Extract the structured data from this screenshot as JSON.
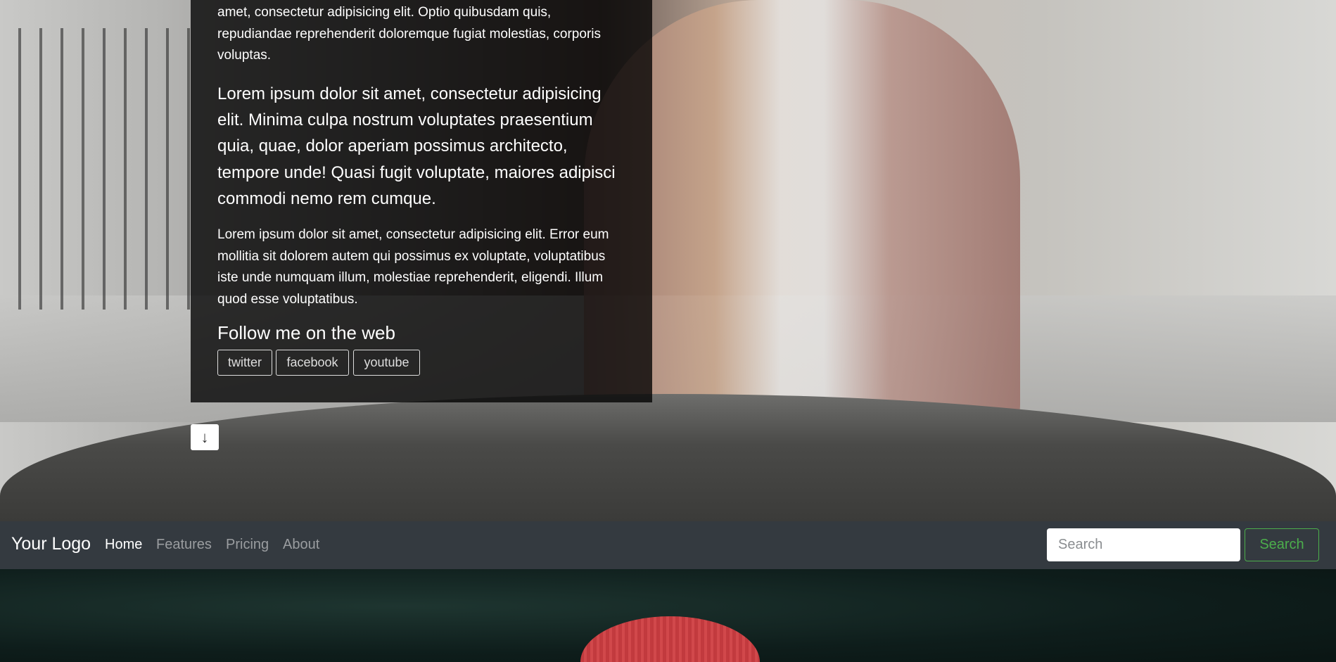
{
  "hero": {
    "paragraph_1": "amet, consectetur adipisicing elit. Optio quibusdam quis, repudiandae reprehenderit doloremque fugiat molestias, corporis voluptas.",
    "lead": "Lorem ipsum dolor sit amet, consectetur adipisicing elit. Minima culpa nostrum voluptates praesentium quia, quae, dolor aperiam possimus architecto, tempore unde! Quasi fugit voluptate, maiores adipisci commodi nemo rem cumque.",
    "paragraph_3": "Lorem ipsum dolor sit amet, consectetur adipisicing elit. Error eum mollitia sit dolorem autem qui possimus ex voluptate, voluptatibus iste unde numquam illum, molestiae reprehenderit, eligendi. Illum quod esse voluptatibus.",
    "follow_heading": "Follow me on the web",
    "social": [
      "twitter",
      "facebook",
      "youtube"
    ],
    "scroll_down_icon": "↓"
  },
  "navbar": {
    "logo": "Your Logo",
    "links": [
      "Home",
      "Features",
      "Pricing",
      "About"
    ],
    "active": "Home",
    "search_placeholder": "Search",
    "search_button": "Search",
    "accent_color": "#4cae4c",
    "background": "#343a40"
  }
}
